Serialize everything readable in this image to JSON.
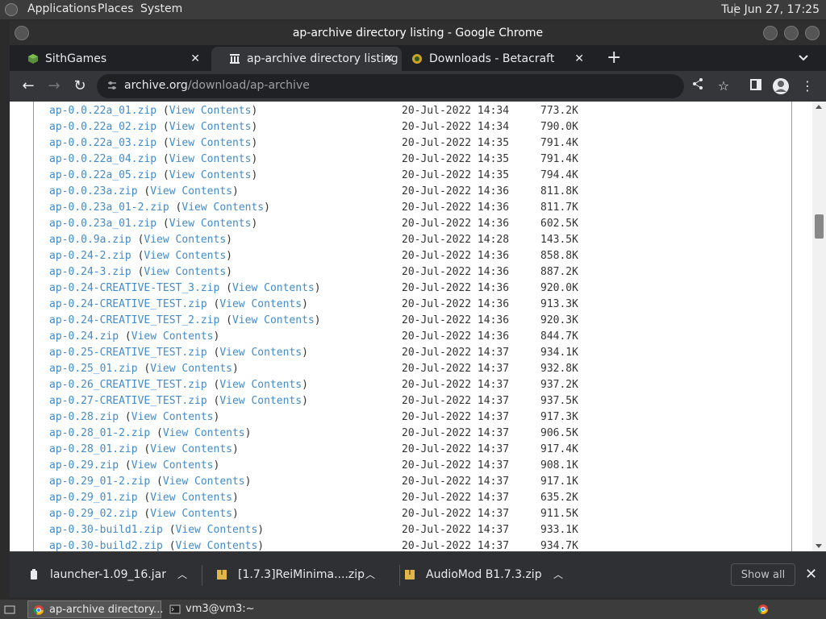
{
  "topbar": {
    "menus": [
      "Applications",
      "Places",
      "System"
    ],
    "clock": "Tue Jun 27, 17:25"
  },
  "window": {
    "title": "ap-archive directory listing - Google Chrome"
  },
  "tabs": [
    {
      "title": "SithGames",
      "close": "✕",
      "active": false
    },
    {
      "title": "ap-archive directory listing",
      "close": "✕",
      "active": true
    },
    {
      "title": "Downloads - Betacraft",
      "close": "✕",
      "active": false
    }
  ],
  "newtab": "+",
  "omnibox": {
    "host": "archive.org",
    "path": "/download/ap-archive"
  },
  "listing": {
    "view_label": "View Contents",
    "rows": [
      {
        "name": "ap-0.0.22a_01.zip",
        "date": "20-Jul-2022 14:34",
        "size": "773.2K"
      },
      {
        "name": "ap-0.0.22a_02.zip",
        "date": "20-Jul-2022 14:34",
        "size": "790.0K"
      },
      {
        "name": "ap-0.0.22a_03.zip",
        "date": "20-Jul-2022 14:35",
        "size": "791.4K"
      },
      {
        "name": "ap-0.0.22a_04.zip",
        "date": "20-Jul-2022 14:35",
        "size": "791.4K"
      },
      {
        "name": "ap-0.0.22a_05.zip",
        "date": "20-Jul-2022 14:35",
        "size": "794.4K"
      },
      {
        "name": "ap-0.0.23a.zip",
        "date": "20-Jul-2022 14:36",
        "size": "811.8K"
      },
      {
        "name": "ap-0.0.23a_01-2.zip",
        "date": "20-Jul-2022 14:36",
        "size": "811.7K"
      },
      {
        "name": "ap-0.0.23a_01.zip",
        "date": "20-Jul-2022 14:36",
        "size": "602.5K"
      },
      {
        "name": "ap-0.0.9a.zip",
        "date": "20-Jul-2022 14:28",
        "size": "143.5K"
      },
      {
        "name": "ap-0.24-2.zip",
        "date": "20-Jul-2022 14:36",
        "size": "858.8K"
      },
      {
        "name": "ap-0.24-3.zip",
        "date": "20-Jul-2022 14:36",
        "size": "887.2K"
      },
      {
        "name": "ap-0.24-CREATIVE-TEST_3.zip",
        "date": "20-Jul-2022 14:36",
        "size": "920.0K"
      },
      {
        "name": "ap-0.24-CREATIVE_TEST.zip",
        "date": "20-Jul-2022 14:36",
        "size": "913.3K"
      },
      {
        "name": "ap-0.24-CREATIVE_TEST_2.zip",
        "date": "20-Jul-2022 14:36",
        "size": "920.3K"
      },
      {
        "name": "ap-0.24.zip",
        "date": "20-Jul-2022 14:36",
        "size": "844.7K"
      },
      {
        "name": "ap-0.25-CREATIVE_TEST.zip",
        "date": "20-Jul-2022 14:37",
        "size": "934.1K"
      },
      {
        "name": "ap-0.25_01.zip",
        "date": "20-Jul-2022 14:37",
        "size": "932.8K"
      },
      {
        "name": "ap-0.26_CREATIVE_TEST.zip",
        "date": "20-Jul-2022 14:37",
        "size": "937.2K"
      },
      {
        "name": "ap-0.27-CREATIVE_TEST.zip",
        "date": "20-Jul-2022 14:37",
        "size": "937.5K"
      },
      {
        "name": "ap-0.28.zip",
        "date": "20-Jul-2022 14:37",
        "size": "917.3K"
      },
      {
        "name": "ap-0.28_01-2.zip",
        "date": "20-Jul-2022 14:37",
        "size": "906.5K"
      },
      {
        "name": "ap-0.28_01.zip",
        "date": "20-Jul-2022 14:37",
        "size": "917.4K"
      },
      {
        "name": "ap-0.29.zip",
        "date": "20-Jul-2022 14:37",
        "size": "908.1K"
      },
      {
        "name": "ap-0.29_01-2.zip",
        "date": "20-Jul-2022 14:37",
        "size": "917.1K"
      },
      {
        "name": "ap-0.29_01.zip",
        "date": "20-Jul-2022 14:37",
        "size": "635.2K"
      },
      {
        "name": "ap-0.29_02.zip",
        "date": "20-Jul-2022 14:37",
        "size": "911.5K"
      },
      {
        "name": "ap-0.30-build1.zip",
        "date": "20-Jul-2022 14:37",
        "size": "933.1K"
      },
      {
        "name": "ap-0.30-build2.zip",
        "date": "20-Jul-2022 14:37",
        "size": "934.7K"
      }
    ]
  },
  "downloads": {
    "items": [
      "launcher-1.09_16.jar",
      "[1.7.3]ReiMinima....zip",
      "AudioMod B1.7.3.zip"
    ],
    "show_all": "Show all"
  },
  "taskbar": {
    "tasks": [
      "ap-archive directory...",
      "vm3@vm3:~"
    ]
  },
  "colors": {
    "link": "#428bca",
    "chrome_dark": "#35363a"
  }
}
